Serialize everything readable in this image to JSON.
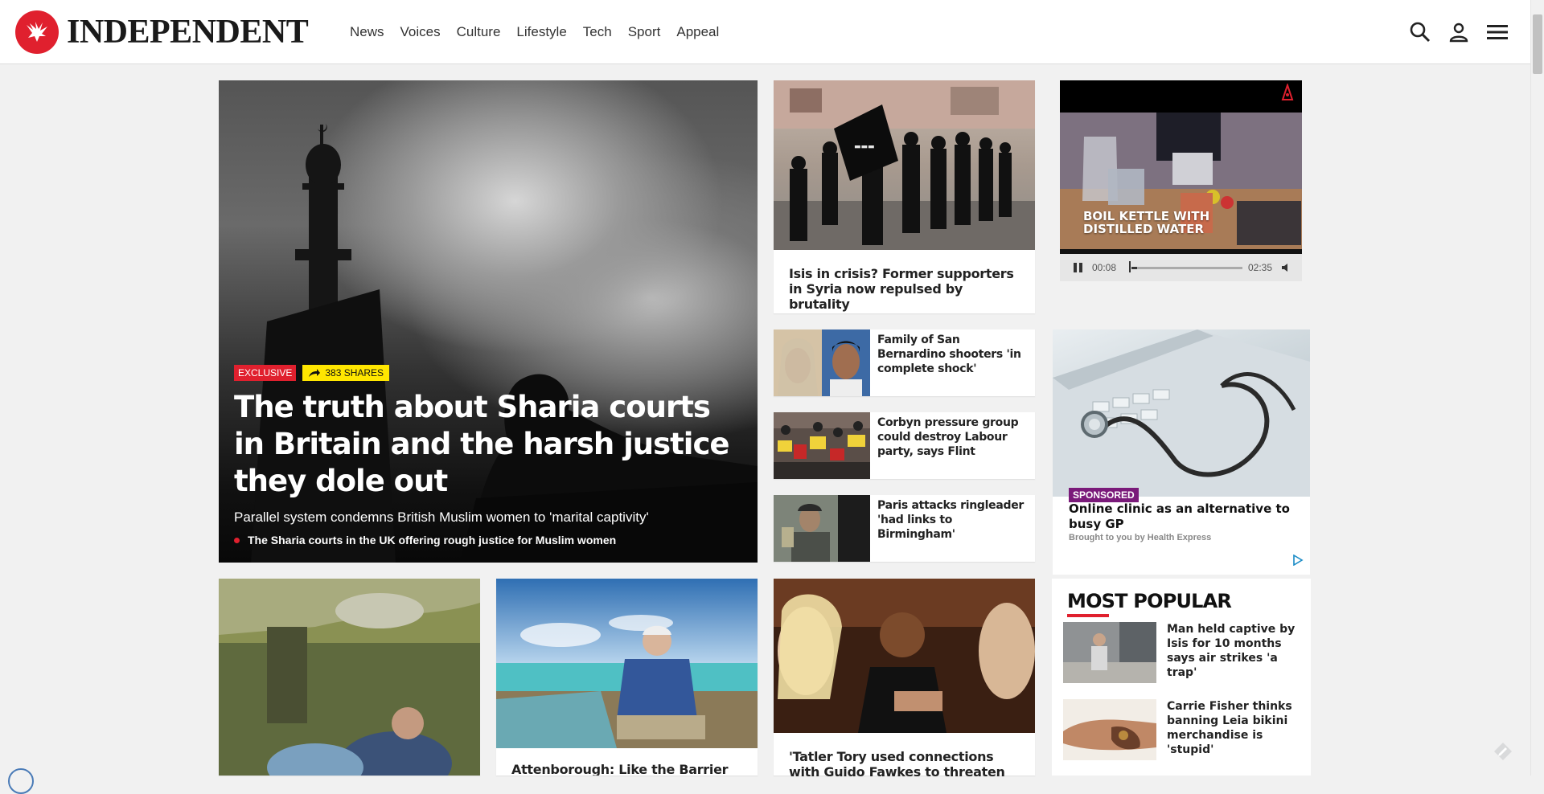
{
  "header": {
    "logo_text": "INDEPENDENT",
    "nav": [
      "News",
      "Voices",
      "Culture",
      "Lifestyle",
      "Tech",
      "Sport",
      "Appeal"
    ],
    "icons": [
      "search-icon",
      "user-icon",
      "menu-icon"
    ]
  },
  "lead": {
    "badge_exclusive": "EXCLUSIVE",
    "shares": "383 SHARES",
    "title": "The truth about Sharia courts in Britain and the harsh justice they dole out",
    "standfirst": "Parallel system condemns British Muslim women to 'marital captivity'",
    "related": "The Sharia courts in the UK offering rough justice for Muslim women"
  },
  "stories": {
    "isis": "Isis in crisis? Former supporters in Syria now repulsed by brutality",
    "san_bernardino": "Family of San Bernardino shooters 'in complete shock'",
    "corbyn": "Corbyn pressure group could destroy Labour party, says Flint",
    "paris": "Paris attacks ringleader 'had links to Birmingham'",
    "attenborough": "Attenborough: Like the Barrier Reef,",
    "tatler": "'Tatler Tory used connections with Guido Fawkes to threaten"
  },
  "video": {
    "overlay": "BOIL KETTLE WITH DISTILLED WATER",
    "current": "00:08",
    "duration": "02:35",
    "progress": 0.05
  },
  "ad": {
    "label": "SPONSORED",
    "title": "Online clinic as an alternative to busy GP",
    "by": "Brought to you by Health Express"
  },
  "popular": {
    "heading": "MOST POPULAR",
    "items": [
      "Man held captive by Isis for 10 months says air strikes 'a trap'",
      "Carrie Fisher thinks banning Leia bikini merchandise is 'stupid'"
    ]
  },
  "colors": {
    "brand_red": "#e0202e",
    "share_yellow": "#ffe600",
    "sponsored_purple": "#7a1a7a"
  }
}
